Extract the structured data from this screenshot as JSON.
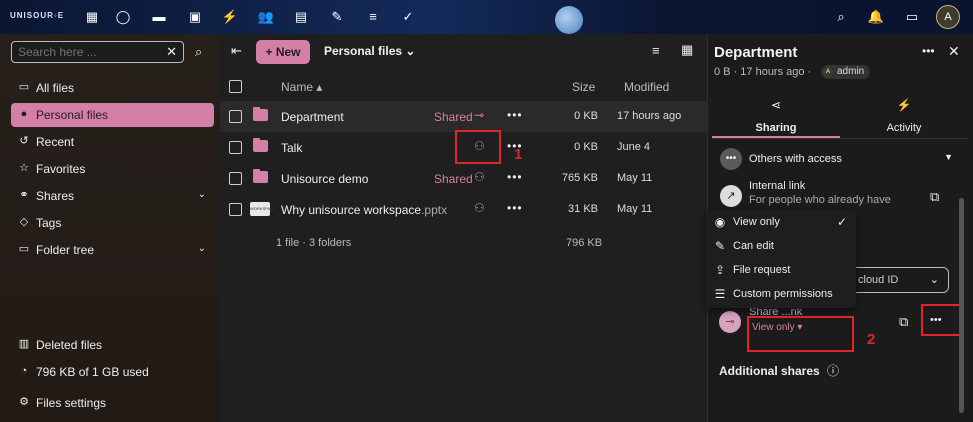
{
  "topbar": {
    "logo": "UNISOUR◦E",
    "icons": [
      "apps-icon",
      "dashboard-icon",
      "files-icon",
      "photos-icon",
      "activity-icon",
      "contacts-icon",
      "calendar-icon",
      "notes-icon",
      "deck-icon",
      "tasks-icon",
      "search-icon",
      "notifications-icon",
      "contacts-menu-icon"
    ],
    "avatar_letter": "A"
  },
  "leftnav": {
    "search_placeholder": "Search here ...",
    "items": [
      {
        "label": "All files",
        "icon": "folder-icon"
      },
      {
        "label": "Personal files",
        "icon": "user-icon",
        "active": true
      },
      {
        "label": "Recent",
        "icon": "history-icon"
      },
      {
        "label": "Favorites",
        "icon": "star-icon"
      },
      {
        "label": "Shares",
        "icon": "share-icon",
        "expandable": true
      },
      {
        "label": "Tags",
        "icon": "tag-icon"
      },
      {
        "label": "Folder tree",
        "icon": "folder-tree-icon",
        "expandable": true
      }
    ],
    "bottom": [
      {
        "label": "Deleted files",
        "icon": "trash-icon"
      },
      {
        "label": "796 KB of 1 GB used",
        "icon": "quota-icon"
      },
      {
        "label": "Files settings",
        "icon": "gear-icon"
      }
    ]
  },
  "main": {
    "new_label": "New",
    "breadcrumb": "Personal files",
    "columns": {
      "name": "Name",
      "size": "Size",
      "modified": "Modified"
    },
    "rows": [
      {
        "name": "Department",
        "shared": "Shared",
        "size": "0 KB",
        "modified": "17 hours ago"
      },
      {
        "name": "Talk",
        "shared": "",
        "size": "0 KB",
        "modified": "June 4"
      },
      {
        "name": "Unisource demo",
        "shared": "Shared",
        "size": "765 KB",
        "modified": "May 11"
      },
      {
        "name": "Why unisource workspace",
        "ext": ".pptx",
        "shared": "",
        "size": "31 KB",
        "modified": "May 11",
        "thumb": "WORKSPACE"
      }
    ],
    "summary": "1 file · 3 folders",
    "summary_size": "796 KB",
    "annotation_1": "1"
  },
  "sidebar": {
    "title": "Department",
    "meta": "0 B · 17 hours ago ·",
    "owner": "admin",
    "owner_initial": "A",
    "tabs": [
      {
        "label": "Sharing"
      },
      {
        "label": "Activity"
      }
    ],
    "others_label": "Others with access",
    "internal_link": "Internal link",
    "internal_desc": "For people who already have",
    "search_suffix": "cloud ID",
    "share_link_partial": "Share ...nk",
    "view_only": "View only",
    "additional_shares": "Additional shares",
    "annotation_2": "2"
  },
  "menu": {
    "items": [
      {
        "label": "View only",
        "icon": "eye-icon",
        "checked": true
      },
      {
        "label": "Can edit",
        "icon": "pencil-icon"
      },
      {
        "label": "File request",
        "icon": "upload-icon"
      },
      {
        "label": "Custom permissions",
        "icon": "tune-icon"
      }
    ]
  },
  "colors": {
    "accent": "#d47fa5",
    "annotation": "#e0242b"
  }
}
